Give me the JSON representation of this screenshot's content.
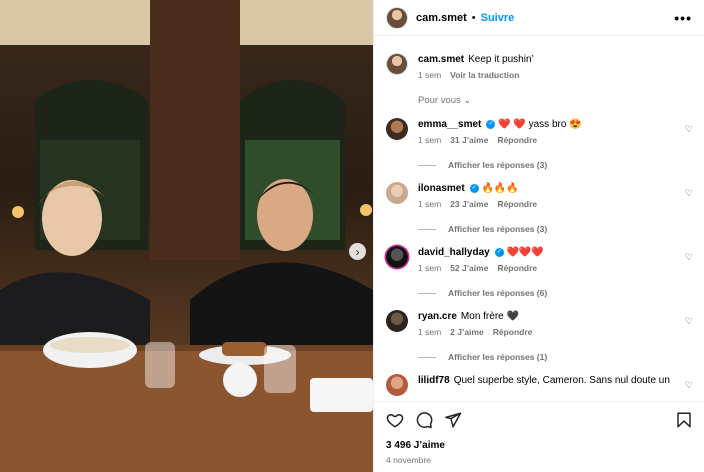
{
  "post": {
    "username": "cam.smet",
    "separator": "•",
    "follow_label": "Suivre",
    "more_label": "•••",
    "next_arrow": "›"
  },
  "caption": {
    "username": "cam.smet",
    "text": "Keep it pushin’",
    "time": "1 sem",
    "translate_label": "Voir la traduction"
  },
  "pour_vous": "Pour vous ⌄",
  "comments": [
    {
      "username": "emma__smet",
      "verified": true,
      "text": "❤️ ❤️ yass bro 😍",
      "time": "1 sem",
      "likes": "31 J’aime",
      "reply": "Répondre",
      "replies": "Afficher les réponses (3)"
    },
    {
      "username": "ilonasmet",
      "verified": true,
      "text": "🔥🔥🔥",
      "time": "1 sem",
      "likes": "23 J’aime",
      "reply": "Répondre",
      "replies": "Afficher les réponses (3)"
    },
    {
      "username": "david_hallyday",
      "verified": true,
      "text": "❤️❤️❤️",
      "time": "1 sem",
      "likes": "52 J’aime",
      "reply": "Répondre",
      "replies": "Afficher les réponses (6)"
    },
    {
      "username": "ryan.cre",
      "verified": false,
      "text": "Mon frère 🖤",
      "time": "1 sem",
      "likes": "2 J’aime",
      "reply": "Répondre",
      "replies": "Afficher les réponses (1)"
    },
    {
      "username": "lilidf78",
      "verified": false,
      "text": "Quel superbe style, Cameron. Sans nul doute un",
      "time": "",
      "likes": "",
      "reply": "",
      "replies": ""
    }
  ],
  "footer": {
    "likes": "3 496 J’aime",
    "date": "4 novembre"
  },
  "icons": {
    "heart": "heart-icon",
    "comment": "comment-icon",
    "share": "share-icon",
    "bookmark": "bookmark-icon"
  }
}
